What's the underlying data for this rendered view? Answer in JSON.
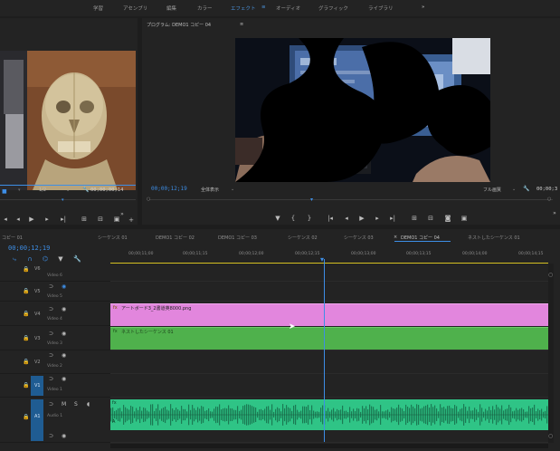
{
  "workspace": {
    "tabs": [
      "学習",
      "アセンブリ",
      "編集",
      "カラー",
      "エフェクト",
      "オーディオ",
      "グラフィック",
      "ライブラリ"
    ],
    "active_tab": "エフェクト",
    "menu_glyph": "≡",
    "more_glyph": "»"
  },
  "source_monitor": {
    "zoom_value": "1/2",
    "timecode": "00;00;00;14"
  },
  "program_monitor": {
    "title": "プログラム: DEMO1 コピー 04",
    "menu_glyph": "≡",
    "timecode_current": "00;00;12;19",
    "fit_label": "全体表示",
    "quality_label": "フル画質",
    "timecode_end": "00;00;3"
  },
  "timeline": {
    "tabs": [
      "コピー 01",
      "シーケンス 01",
      "DEMO1 コピー 02",
      "DEMO1 コピー 03",
      "シーケンス 02",
      "シーケンス 03",
      "DEMO1 コピー 04",
      "ネストしたシーケンス 01"
    ],
    "active_tab": "DEMO1 コピー 04",
    "close_glyph": "×",
    "timecode": "00;00;12;19",
    "ruler": [
      "00;00;11;00",
      "00;00;11;15",
      "00;00;12;00",
      "00;00;12;15",
      "00;00;13;00",
      "00;00;13;15",
      "00;00;14;00",
      "00;00;14;15"
    ],
    "tracks": [
      {
        "id": "V6",
        "name": "Video 6"
      },
      {
        "id": "V5",
        "name": "Video 5"
      },
      {
        "id": "V4",
        "name": "Video 4"
      },
      {
        "id": "V3",
        "name": "Video 3"
      },
      {
        "id": "V2",
        "name": "Video 2"
      },
      {
        "id": "V1",
        "name": "Video 1"
      },
      {
        "id": "A1",
        "name": "Audio 1"
      }
    ],
    "clips": {
      "v4_label": "アートボード3_2書道英8000.png",
      "v3_label": "ネストしたシーケンス 01",
      "fx_glyph": "fx",
      "audio_a_glyph": "A"
    }
  },
  "colors": {
    "accent_blue": "#3d8ee6",
    "clip_pink": "#e286dd",
    "clip_green": "#4fb14c",
    "clip_audio": "#2fc486",
    "target_blue": "#1f5c92"
  },
  "icons": {
    "wrench": "🔧",
    "play": "▶",
    "step_back": "◀|",
    "step_fwd": "|▶",
    "goto_in": "{←",
    "goto_out": "→}",
    "mark_in": "{",
    "mark_out": "}",
    "marker": "▼",
    "camera": "📷",
    "plus": "+",
    "eye": "◉",
    "lock": "🔒",
    "chevron_down": "⌄",
    "more": "»"
  }
}
